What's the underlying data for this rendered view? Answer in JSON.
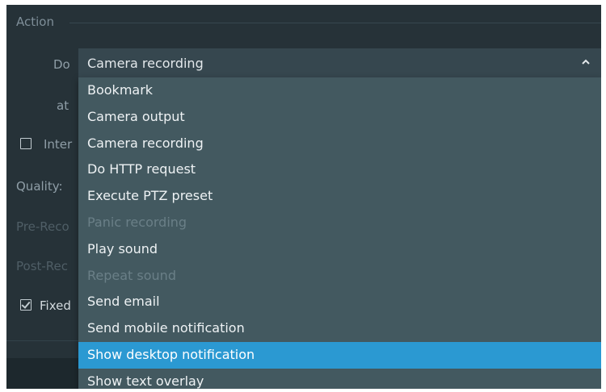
{
  "section": {
    "title": "Action"
  },
  "form": {
    "do_label": "Do",
    "at_label": "at",
    "interval_label": "Inter",
    "quality_label": "Quality:",
    "pre_record_label": "Pre-Reco",
    "post_record_label": "Post-Rec",
    "fixed_label": "Fixed",
    "interval_checked": false,
    "fixed_checked": true
  },
  "action_select": {
    "value": "Camera recording",
    "expanded": true,
    "options": [
      {
        "label": "Bookmark",
        "disabled": false,
        "selected": false
      },
      {
        "label": "Camera output",
        "disabled": false,
        "selected": false
      },
      {
        "label": "Camera recording",
        "disabled": false,
        "selected": false
      },
      {
        "label": "Do HTTP request",
        "disabled": false,
        "selected": false
      },
      {
        "label": "Execute PTZ preset",
        "disabled": false,
        "selected": false
      },
      {
        "label": "Panic recording",
        "disabled": true,
        "selected": false
      },
      {
        "label": "Play sound",
        "disabled": false,
        "selected": false
      },
      {
        "label": "Repeat sound",
        "disabled": true,
        "selected": false
      },
      {
        "label": "Send email",
        "disabled": false,
        "selected": false
      },
      {
        "label": "Send mobile notification",
        "disabled": false,
        "selected": false
      },
      {
        "label": "Show desktop notification",
        "disabled": false,
        "selected": true
      },
      {
        "label": "Show text overlay",
        "disabled": false,
        "selected": false
      }
    ]
  },
  "colors": {
    "panel_bg": "#263238",
    "dropdown_bg": "#435960",
    "highlight": "#2b99d2",
    "disabled_text": "#6a7f87"
  },
  "icons": {
    "combo_arrow": "chevron-up-icon",
    "interval_checkbox": "checkbox-unchecked-icon",
    "fixed_checkbox": "checkbox-checked-icon"
  }
}
